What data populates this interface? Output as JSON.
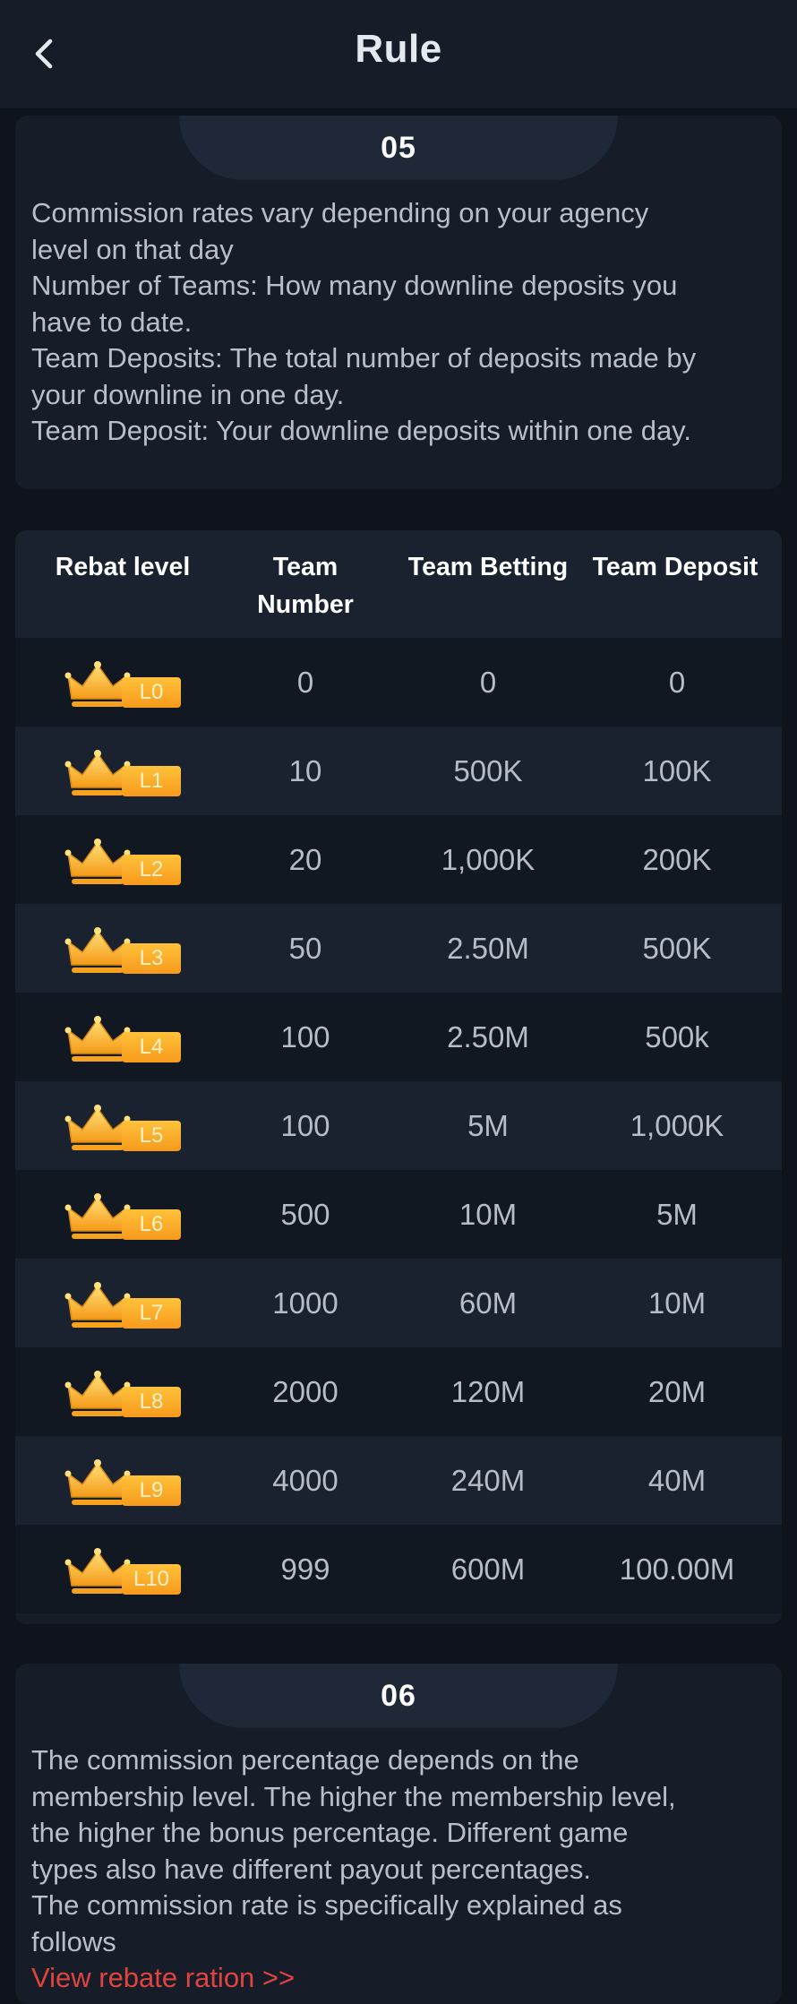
{
  "header": {
    "title": "Rule",
    "back_icon": "chevron-left-icon"
  },
  "section05": {
    "number": "05",
    "lines": [
      "Commission rates vary depending on your agency",
      "level on that day",
      "Number of Teams: How many downline deposits you",
      "have to date.",
      "Team Deposits: The total number of deposits made by",
      "your downline in one day.",
      "Team Deposit: Your downline deposits within one day."
    ]
  },
  "table": {
    "headers": {
      "level": "Rebat level",
      "team_number_line1": "Team",
      "team_number_line2": "Number",
      "team_betting": "Team Betting",
      "team_deposit": "Team Deposit"
    },
    "rows": [
      {
        "level": "L0",
        "team_number": "0",
        "team_betting": "0",
        "team_deposit": "0"
      },
      {
        "level": "L1",
        "team_number": "10",
        "team_betting": "500K",
        "team_deposit": "100K"
      },
      {
        "level": "L2",
        "team_number": "20",
        "team_betting": "1,000K",
        "team_deposit": "200K"
      },
      {
        "level": "L3",
        "team_number": "50",
        "team_betting": "2.50M",
        "team_deposit": "500K"
      },
      {
        "level": "L4",
        "team_number": "100",
        "team_betting": "2.50M",
        "team_deposit": "500k"
      },
      {
        "level": "L5",
        "team_number": "100",
        "team_betting": "5M",
        "team_deposit": "1,000K"
      },
      {
        "level": "L6",
        "team_number": "500",
        "team_betting": "10M",
        "team_deposit": "5M"
      },
      {
        "level": "L7",
        "team_number": "1000",
        "team_betting": "60M",
        "team_deposit": "10M"
      },
      {
        "level": "L8",
        "team_number": "2000",
        "team_betting": "120M",
        "team_deposit": "20M"
      },
      {
        "level": "L9",
        "team_number": "4000",
        "team_betting": "240M",
        "team_deposit": "40M"
      },
      {
        "level": "L10",
        "team_number": "999",
        "team_betting": "600M",
        "team_deposit": "100.00M"
      }
    ]
  },
  "section06": {
    "number": "06",
    "lines": [
      "The commission percentage depends on the",
      "membership level. The higher the membership level,",
      "the higher the bonus percentage. Different game",
      "types also have different payout percentages.",
      "The commission rate is specifically explained as",
      "follows"
    ],
    "link": "View rebate ration >>"
  },
  "colors": {
    "background": "#0e131c",
    "card": "#161d29",
    "accent_link": "#e0443e",
    "badge": "#f7a21f"
  }
}
